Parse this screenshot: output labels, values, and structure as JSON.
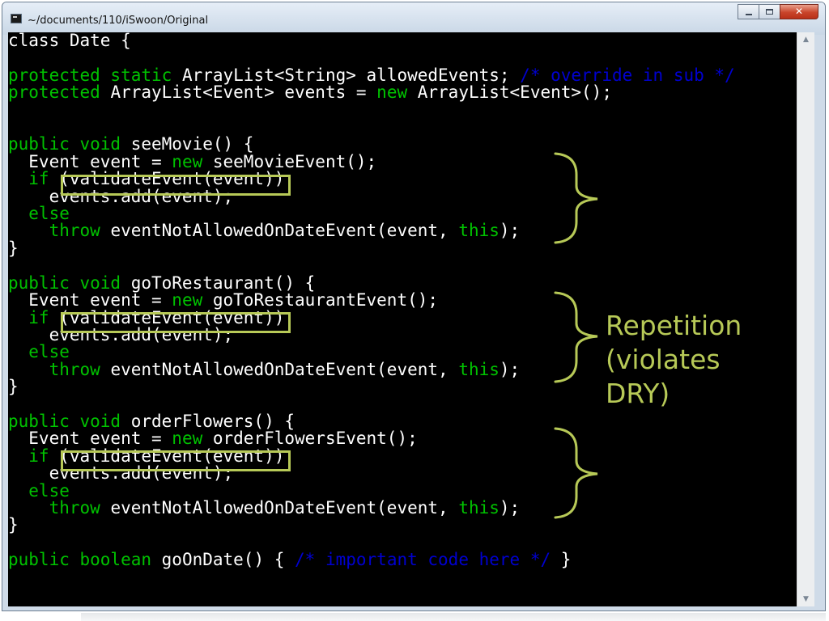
{
  "window": {
    "title": "~/documents/110/iSwoon/Original"
  },
  "colors": {
    "console_bg": "#000000",
    "text": "#ffffff",
    "keyword": "#00c200",
    "comment": "#0000d0",
    "annotation": "#b7c957"
  },
  "code": [
    [
      [
        "class Date {",
        ""
      ]
    ],
    [
      [
        "",
        ""
      ]
    ],
    [
      [
        "protected static ",
        "k"
      ],
      [
        "ArrayList<String> allowedEvents; ",
        ""
      ],
      [
        "/* override in sub */",
        "c"
      ]
    ],
    [
      [
        "protected ",
        "k"
      ],
      [
        "ArrayList<Event> events = ",
        ""
      ],
      [
        "new ",
        "k"
      ],
      [
        "ArrayList<Event>();",
        ""
      ]
    ],
    [
      [
        "",
        ""
      ]
    ],
    [
      [
        "",
        ""
      ]
    ],
    [
      [
        "public void ",
        "k"
      ],
      [
        "seeMovie() {",
        ""
      ]
    ],
    [
      [
        "  Event event = ",
        ""
      ],
      [
        "new ",
        "k"
      ],
      [
        "seeMovieEvent();",
        ""
      ]
    ],
    [
      [
        "  if ",
        "k"
      ],
      [
        "(validateEvent(event))",
        ""
      ]
    ],
    [
      [
        "    events.add(event);",
        ""
      ]
    ],
    [
      [
        "  else",
        "k"
      ]
    ],
    [
      [
        "    throw ",
        "k"
      ],
      [
        "eventNotAllowedOnDateEvent(event, ",
        ""
      ],
      [
        "this",
        "k"
      ],
      [
        ");",
        ""
      ]
    ],
    [
      [
        "}",
        ""
      ]
    ],
    [
      [
        "",
        ""
      ]
    ],
    [
      [
        "public void ",
        "k"
      ],
      [
        "goToRestaurant() {",
        ""
      ]
    ],
    [
      [
        "  Event event = ",
        ""
      ],
      [
        "new ",
        "k"
      ],
      [
        "goToRestaurantEvent();",
        ""
      ]
    ],
    [
      [
        "  if ",
        "k"
      ],
      [
        "(validateEvent(event))",
        ""
      ]
    ],
    [
      [
        "    events.add(event);",
        ""
      ]
    ],
    [
      [
        "  else",
        "k"
      ]
    ],
    [
      [
        "    throw ",
        "k"
      ],
      [
        "eventNotAllowedOnDateEvent(event, ",
        ""
      ],
      [
        "this",
        "k"
      ],
      [
        ");",
        ""
      ]
    ],
    [
      [
        "}",
        ""
      ]
    ],
    [
      [
        "",
        ""
      ]
    ],
    [
      [
        "public void ",
        "k"
      ],
      [
        "orderFlowers() {",
        ""
      ]
    ],
    [
      [
        "  Event event = ",
        ""
      ],
      [
        "new ",
        "k"
      ],
      [
        "orderFlowersEvent();",
        ""
      ]
    ],
    [
      [
        "  if ",
        "k"
      ],
      [
        "(validateEvent(event))",
        ""
      ]
    ],
    [
      [
        "    events.add(event);",
        ""
      ]
    ],
    [
      [
        "  else",
        "k"
      ]
    ],
    [
      [
        "    throw ",
        "k"
      ],
      [
        "eventNotAllowedOnDateEvent(event, ",
        ""
      ],
      [
        "this",
        "k"
      ],
      [
        ");",
        ""
      ]
    ],
    [
      [
        "}",
        ""
      ]
    ],
    [
      [
        "",
        ""
      ]
    ],
    [
      [
        "public boolean ",
        "k"
      ],
      [
        "goOnDate() { ",
        ""
      ],
      [
        "/* important code here */",
        "c"
      ],
      [
        " }",
        ""
      ]
    ]
  ],
  "annotation": {
    "label": "Repetition\n(violates\nDRY)"
  }
}
